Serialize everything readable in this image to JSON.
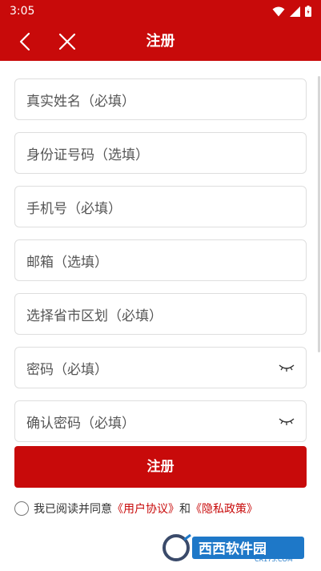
{
  "status_bar": {
    "time": "3:05"
  },
  "header": {
    "title": "注册"
  },
  "form": {
    "fields": [
      {
        "placeholder": "真实姓名（必填）"
      },
      {
        "placeholder": "身份证号码（选填）"
      },
      {
        "placeholder": "手机号（必填）"
      },
      {
        "placeholder": "邮箱（选填）"
      },
      {
        "placeholder": "选择省市区划（必填）"
      },
      {
        "placeholder": "密码（必填）"
      },
      {
        "placeholder": "确认密码（必填）"
      }
    ],
    "submit_label": "注册"
  },
  "agreement": {
    "prefix": "我已阅读并同意",
    "user_agreement": "《用户协议》",
    "connector": "和",
    "privacy_policy": "《隐私政策》"
  },
  "watermark": {
    "brand": "西西软件园",
    "site": "CR173.COM"
  },
  "colors": {
    "primary": "#c80a0a"
  }
}
